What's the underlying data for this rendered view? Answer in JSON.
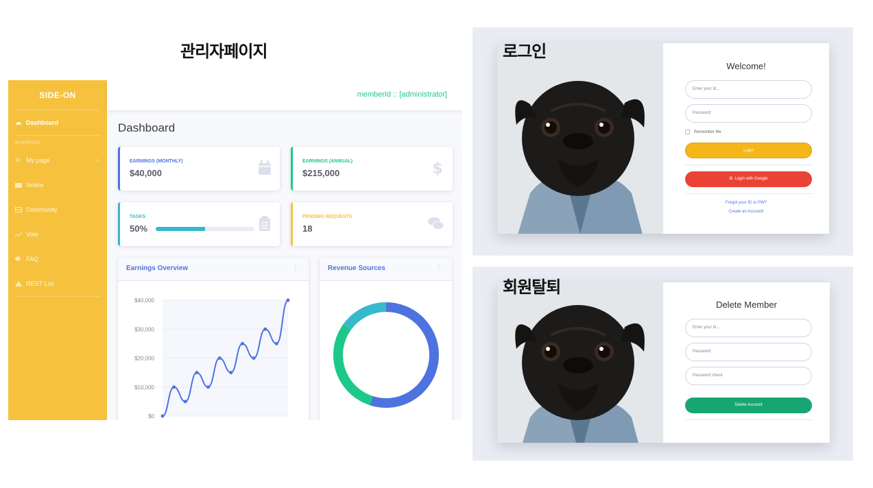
{
  "captions": {
    "admin": "관리자페이지",
    "login": "로그인",
    "delete": "회원탈퇴"
  },
  "admin": {
    "brand": "SIDE-ON",
    "user_label": "memberId :: [administrator]",
    "page_title": "Dashboard",
    "sidebar": {
      "dashboard": "Dashboard",
      "section_heading": "INTERFACE",
      "items": [
        "My page",
        "Notice",
        "Community",
        "Vote",
        "FAQ",
        "REST List"
      ]
    },
    "stats": [
      {
        "label": "EARNINGS (MONTHLY)",
        "value": "$40,000",
        "icon": "calendar-icon",
        "color": "#4e73df"
      },
      {
        "label": "EARNINGS (ANNUAL)",
        "value": "$215,000",
        "icon": "dollar-icon",
        "color": "#1cc88a"
      },
      {
        "label": "TASKS",
        "value": "50%",
        "progress": 0.5,
        "icon": "clipboard-icon",
        "color": "#36b9cc"
      },
      {
        "label": "PENDING REQUESTS",
        "value": "18",
        "icon": "comments-icon",
        "color": "#f6c23e"
      }
    ],
    "earnings_panel": {
      "title": "Earnings Overview",
      "menu": "⋮"
    },
    "revenue_panel": {
      "title": "Revenue Sources",
      "menu": "⋮"
    },
    "colors": {
      "sidebar": "#f6c23e",
      "primary": "#4e73df",
      "success": "#1cc88a",
      "info": "#36b9cc"
    }
  },
  "chart_data": [
    {
      "type": "line",
      "title": "Earnings Overview",
      "y_tick_labels": [
        "$0",
        "$10,000",
        "$20,000",
        "$30,000",
        "$40,000"
      ],
      "ylim": [
        0,
        40000
      ],
      "grid": true,
      "series": [
        {
          "values": [
            0,
            10000,
            5000,
            15000,
            10000,
            20000,
            15000,
            25000,
            20000,
            30000,
            25000,
            40000
          ]
        }
      ]
    },
    {
      "type": "pie",
      "subtype": "doughnut",
      "title": "Revenue Sources",
      "series": [
        {
          "values": [
            55,
            30,
            15
          ],
          "colors": [
            "#4e73df",
            "#1cc88a",
            "#36b9cc"
          ]
        }
      ]
    }
  ],
  "login": {
    "title": "Welcome!",
    "id_placeholder": "Enter your Id...",
    "password_placeholder": "Password",
    "remember_label": "Remember Me",
    "login_button": "Login",
    "google_button": "Login with Google",
    "forgot_link": "Forgot your ID or PW?",
    "create_link": "Create an Account!",
    "colors": {
      "login": "#f4b619",
      "google": "#ea4335"
    }
  },
  "delete_member": {
    "title": "Delete Member",
    "id_placeholder": "Enter your Id...",
    "password_placeholder": "Password",
    "password_check_placeholder": "Password check",
    "delete_button": "Delete Account",
    "colors": {
      "delete": "#17a673"
    }
  }
}
